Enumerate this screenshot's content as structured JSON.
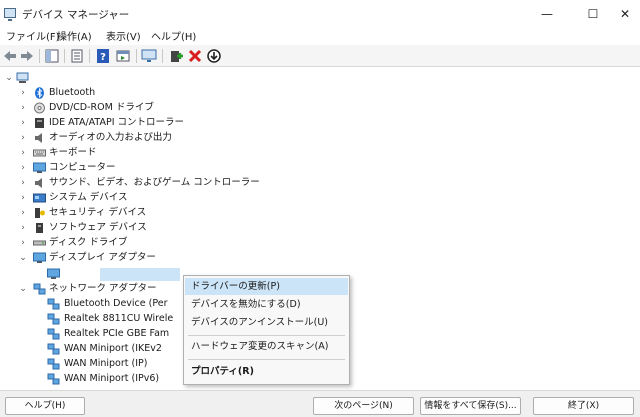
{
  "window": {
    "title": "デバイス マネージャー",
    "minimize_glyph": "—",
    "maximize_glyph": "☐",
    "close_glyph": "✕"
  },
  "menu": [
    "ファイル(F)",
    "操作(A)",
    "表示(V)",
    "ヘルプ(H)"
  ],
  "toolbar_icons": [
    "back-arrow-icon",
    "forward-arrow-icon",
    "show-hide-tree-icon",
    "properties-icon",
    "help-icon",
    "view-icon",
    "scan-monitor-icon",
    "add-driver-icon",
    "uninstall-x-icon",
    "disable-device-icon"
  ],
  "tree": {
    "root_glyph": "⌄",
    "expand_glyph": "›",
    "collapse_glyph": "⌄",
    "items": [
      {
        "label": "Bluetooth"
      },
      {
        "label": "DVD/CD-ROM ドライブ"
      },
      {
        "label": "IDE ATA/ATAPI コントローラー"
      },
      {
        "label": "オーディオの入力および出力"
      },
      {
        "label": "キーボード"
      },
      {
        "label": "コンピューター"
      },
      {
        "label": "サウンド、ビデオ、およびゲーム コントローラー"
      },
      {
        "label": "システム デバイス"
      },
      {
        "label": "セキュリティ デバイス"
      },
      {
        "label": "ソフトウェア デバイス"
      },
      {
        "label": "ディスク ドライブ"
      },
      {
        "label": "ディスプレイ アダプター"
      },
      {
        "label": "ネットワーク アダプター"
      }
    ],
    "network_children": [
      {
        "label": "Bluetooth Device (Per"
      },
      {
        "label": "Realtek 8811CU Wirele"
      },
      {
        "label": "Realtek PCIe GBE Fam"
      },
      {
        "label": "WAN Miniport (IKEv2"
      },
      {
        "label": "WAN Miniport (IP)"
      },
      {
        "label": "WAN Miniport (IPv6)"
      }
    ]
  },
  "context_menu": {
    "update_driver": "ドライバーの更新(P)",
    "disable": "デバイスを無効にする(D)",
    "uninstall": "デバイスのアンインストール(U)",
    "scan": "ハードウェア変更のスキャン(A)",
    "properties": "プロパティ(R)"
  },
  "buttons": {
    "help": "ヘルプ(H)",
    "next": "次のページ(N)",
    "save_all": "情報をすべて保存(S)...",
    "exit": "終了(X)"
  },
  "colors": {
    "selection": "#cce4f7",
    "accent_blue": "#1e88d6",
    "delete_red": "#d81e1e"
  }
}
